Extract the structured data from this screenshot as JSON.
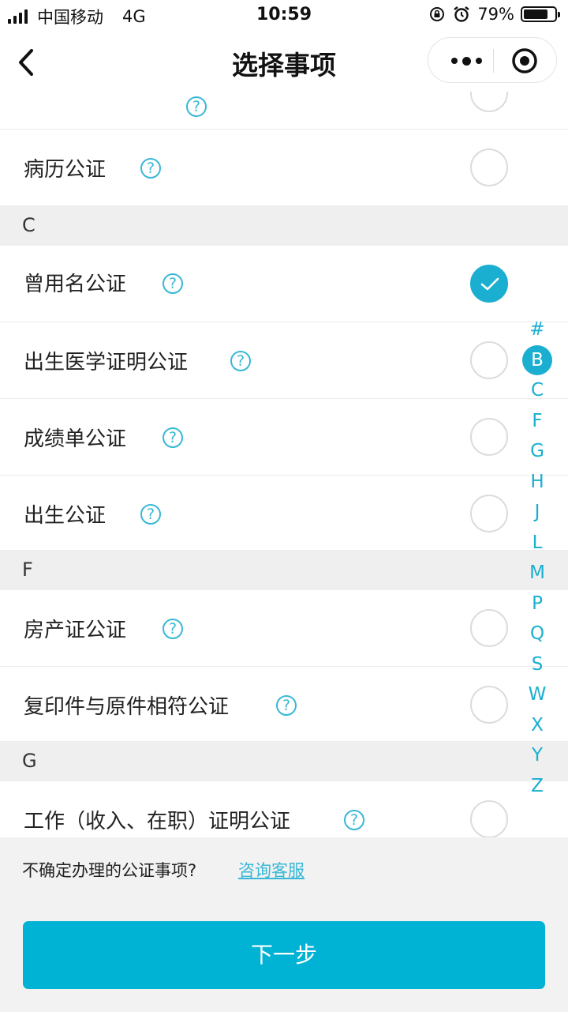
{
  "status_bar": {
    "carrier": "中国移动",
    "network": "4G",
    "time": "10:59",
    "battery_text": "79%",
    "battery_level": 0.79
  },
  "nav": {
    "title": "选择事项"
  },
  "sections": [
    {
      "letter": "C"
    },
    {
      "letter": "F"
    },
    {
      "letter": "G"
    }
  ],
  "items": [
    {
      "label": "病历公证",
      "checked": false
    },
    {
      "label": "曾用名公证",
      "checked": true
    },
    {
      "label": "出生医学证明公证",
      "checked": false
    },
    {
      "label": "成绩单公证",
      "checked": false
    },
    {
      "label": "出生公证",
      "checked": false
    },
    {
      "label": "房产证公证",
      "checked": false
    },
    {
      "label": "复印件与原件相符公证",
      "checked": false
    },
    {
      "label": "工作（收入、在职）证明公证",
      "checked": false
    }
  ],
  "index_letters": [
    "#",
    "B",
    "C",
    "F",
    "G",
    "H",
    "J",
    "L",
    "M",
    "P",
    "Q",
    "S",
    "W",
    "X",
    "Y",
    "Z"
  ],
  "index_active": "B",
  "footer": {
    "help_text": "不确定办理的公证事项?",
    "help_link": "咨询客服",
    "next_button": "下一步"
  },
  "colors": {
    "accent": "#1aafd0",
    "button": "#00b2d4"
  }
}
